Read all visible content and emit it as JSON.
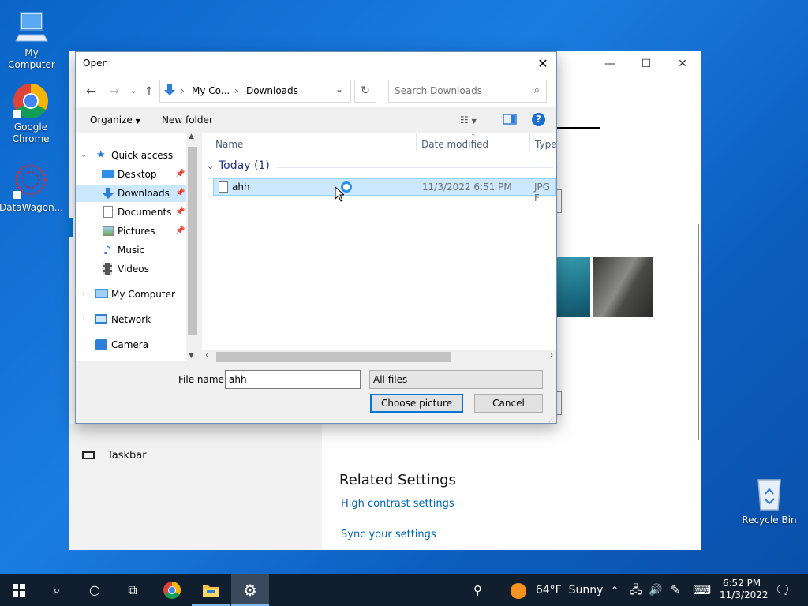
{
  "desktop": {
    "icons": [
      {
        "label": "My Computer",
        "icon": "computer-icon"
      },
      {
        "label": "Google Chrome",
        "icon": "chrome-icon"
      },
      {
        "label": "DataWagon...",
        "icon": "datawagon-icon"
      },
      {
        "label": "Recycle Bin",
        "icon": "recycle-bin-icon"
      }
    ]
  },
  "dialog": {
    "title": "Open",
    "address": {
      "segments": [
        "My Co...",
        "Downloads"
      ]
    },
    "search_placeholder": "Search Downloads",
    "toolbar": {
      "organize": "Organize",
      "new_folder": "New folder"
    },
    "nav_items": [
      {
        "label": "Quick access",
        "icon": "star-icon"
      },
      {
        "label": "Desktop",
        "icon": "desktop-icon",
        "pinned": true
      },
      {
        "label": "Downloads",
        "icon": "download-icon",
        "pinned": true,
        "selected": true
      },
      {
        "label": "Documents",
        "icon": "document-icon",
        "pinned": true
      },
      {
        "label": "Pictures",
        "icon": "pictures-icon",
        "pinned": true
      },
      {
        "label": "Music",
        "icon": "music-icon"
      },
      {
        "label": "Videos",
        "icon": "videos-icon"
      },
      {
        "label": "My Computer",
        "icon": "computer-icon"
      },
      {
        "label": "Network",
        "icon": "network-icon"
      },
      {
        "label": "Camera",
        "icon": "camera-icon"
      }
    ],
    "columns": {
      "name": "Name",
      "date_modified": "Date modified",
      "type": "Type"
    },
    "group_label": "Today (1)",
    "files": [
      {
        "name": "ahh",
        "date_modified": "11/3/2022 6:51 PM",
        "type": "JPG F"
      }
    ],
    "file_name_label": "File name:",
    "file_name_value": "ahh",
    "filter_value": "All files",
    "choose_button": "Choose picture",
    "cancel_button": "Cancel"
  },
  "settings": {
    "taskbar_label": "Taskbar",
    "related_title": "Related Settings",
    "links": [
      "High contrast settings",
      "Sync your settings"
    ]
  },
  "taskbar": {
    "weather": "64°F  Sunny",
    "time": "6:52 PM",
    "date": "11/3/2022"
  },
  "colors": {
    "accent": "#0078d7",
    "link": "#0067b8",
    "selection": "#cce8ff"
  }
}
